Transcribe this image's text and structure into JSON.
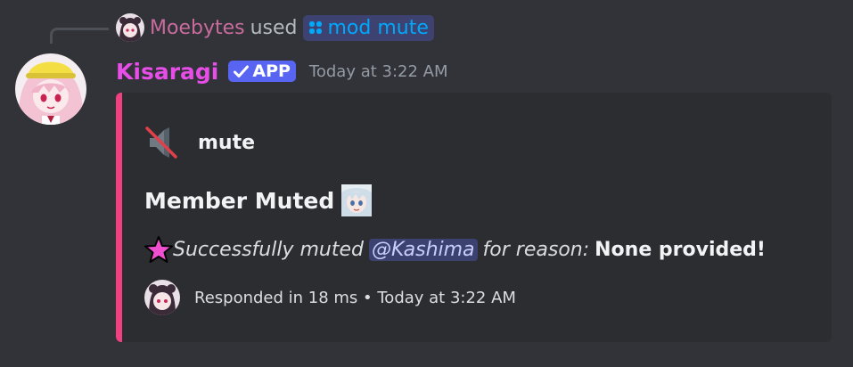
{
  "reply": {
    "user": "Moebytes",
    "used_text": "used",
    "command": "mod mute"
  },
  "message": {
    "author": "Kisaragi",
    "app_tag": "APP",
    "timestamp": "Today at 3:22 AM"
  },
  "embed": {
    "accent_color": "#f1407f",
    "author_icon": "muted-speaker-icon",
    "author_name": "mute",
    "title": "Member Muted",
    "description": {
      "prefix": "Successfully muted",
      "mention": "@Kashima",
      "middle": "for reason:",
      "reason": "None provided!"
    },
    "footer": "Responded in 18 ms • Today at 3:22 AM"
  },
  "colors": {
    "background": "#313338",
    "embed_background": "#2b2d31",
    "username": "#e74de7",
    "reply_user": "#c96b9c",
    "app_badge": "#5865f2",
    "command_link": "#00a8fc"
  }
}
